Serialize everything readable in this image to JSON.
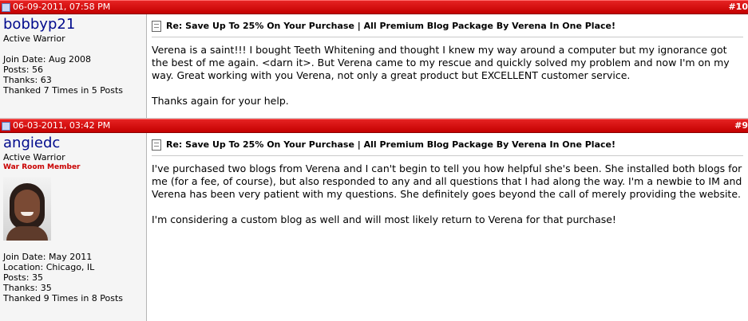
{
  "posts": [
    {
      "date": "06-09-2011, 07:58 PM",
      "postnum": "#10",
      "username": "bobbyp21",
      "user_title": "Active Warrior",
      "badge": "",
      "stats": [
        "Join Date: Aug 2008",
        "Posts: 56",
        "Thanks: 63",
        "Thanked 7 Times in 5 Posts"
      ],
      "title": "Re: Save Up To 25% On Your Purchase | All Premium Blog Package By Verena In One Place!",
      "message": [
        "Verena is a saint!!! I bought Teeth Whitening and thought I knew my way around a computer but my ignorance got the best of me again. <darn it>. But Verena came to my rescue and quickly solved my problem and now I'm on my way. Great working with you Verena, not only a great product but EXCELLENT customer service.",
        "Thanks again for your help."
      ]
    },
    {
      "date": "06-03-2011, 03:42 PM",
      "postnum": "#9",
      "username": "angiedc",
      "user_title": "Active Warrior",
      "badge": "War Room Member",
      "stats": [
        "Join Date: May 2011",
        "Location: Chicago, IL",
        "Posts: 35",
        "Thanks: 35",
        "Thanked 9 Times in 8 Posts"
      ],
      "title": "Re: Save Up To 25% On Your Purchase | All Premium Blog Package By Verena In One Place!",
      "message": [
        "I've purchased two blogs from Verena and I can't begin to tell you how helpful she's been. She installed both blogs for me (for a fee, of course), but also responded to any and all questions that I had along the way. I'm a newbie to IM and Verena has been very patient with my questions. She definitely goes beyond the call of merely providing the website.",
        "I'm considering a custom blog as well and will most likely return to Verena for that purchase!"
      ]
    }
  ]
}
